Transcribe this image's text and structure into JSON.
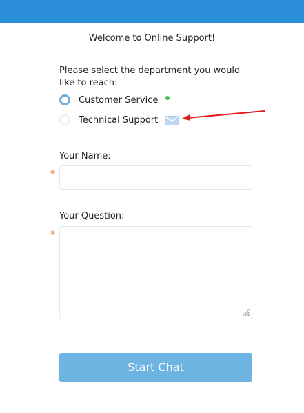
{
  "header": {
    "color": "#2a8fd8"
  },
  "welcome_text": "Welcome to Online Support!",
  "department": {
    "prompt": "Please select the department you would like to reach:",
    "options": [
      {
        "label": "Customer Service",
        "selected": true,
        "status": "online",
        "status_color": "#3cc24a"
      },
      {
        "label": "Technical Support",
        "selected": false,
        "status": "offline-email",
        "icon": "envelope-icon"
      }
    ]
  },
  "annotation": {
    "icon": "red-arrow-icon",
    "color": "#e01b1b"
  },
  "form": {
    "name_label": "Your Name:",
    "name_value": "",
    "question_label": "Your Question:",
    "question_value": "",
    "required_marker": "*",
    "required_color": "#f07b35"
  },
  "button": {
    "label": "Start Chat",
    "color": "#6eb4e3"
  }
}
